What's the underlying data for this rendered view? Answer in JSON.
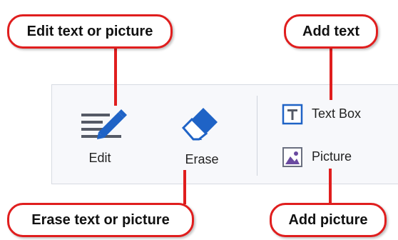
{
  "callouts": {
    "edit": "Edit text or picture",
    "add_text": "Add text",
    "erase": "Erase text or picture",
    "add_picture": "Add picture"
  },
  "toolbar": {
    "edit_label": "Edit",
    "erase_label": "Erase",
    "text_box_label": "Text Box",
    "picture_label": "Picture"
  },
  "icons": {
    "edit": "pencil-lines-icon",
    "erase": "eraser-icon",
    "text_box": "text-box-icon",
    "picture": "picture-icon"
  },
  "colors": {
    "callout_border": "#e01e1e",
    "icon_blue": "#1f63c6",
    "icon_gray": "#555a66",
    "picture_purple": "#6a4aa0"
  }
}
